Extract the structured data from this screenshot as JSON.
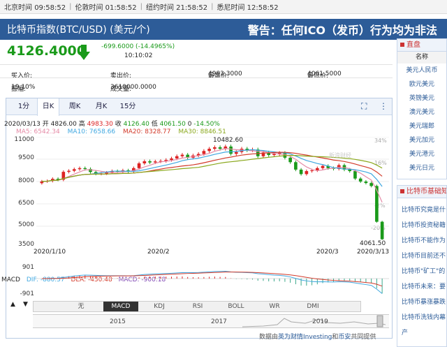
{
  "timebar": {
    "clocks": [
      {
        "city": "北京时间",
        "time": "09:58:52"
      },
      {
        "city": "伦敦时间",
        "time": "01:58:52"
      },
      {
        "city": "纽约时间",
        "time": "21:58:52"
      },
      {
        "city": "悉尼时间",
        "time": "12:58:52"
      }
    ]
  },
  "header": {
    "title": "比特币指数(BTC/USD) (美元/个)",
    "warning": "警告：任何ICO（发币）行为均为非法"
  },
  "quote": {
    "price": "4126.4000",
    "change": "-699.6000 (-14.4965%)",
    "time": "10:10:02",
    "bid_label": "买入价:",
    "bid_value": "--",
    "ask_label": "卖出价:",
    "ask_value": "--",
    "high_label": "最高价:",
    "high_value": "4983.3000",
    "low_label": "最低价:",
    "low_value": "4061.5000",
    "amplitude_label": "振幅:",
    "amplitude_value": "19.10%",
    "volume_label": "成交量:",
    "volume_value": "3610000.0000",
    "down_color": "#1a9a1a"
  },
  "chart_tabs": [
    "1分",
    "日K",
    "周K",
    "月K",
    "15分"
  ],
  "chart_tools": [
    "fullscreen-icon",
    "more-icon"
  ],
  "ohlc": {
    "date": "2020/03/13",
    "open_label": "开",
    "open": "4826.00",
    "high_label": "高",
    "high": "4983.30",
    "close_label": "收",
    "close": "4126.40",
    "low_label": "低",
    "low": "4061.50",
    "volume": "0",
    "pct": "-14.50%"
  },
  "ma": [
    {
      "label": "MA5: 6542.34",
      "color": "#e58aa6"
    },
    {
      "label": "MA10: 7658.66",
      "color": "#3fa7e0"
    },
    {
      "label": "MA20: 8328.77",
      "color": "#d23a2a"
    },
    {
      "label": "MA30: 8846.51",
      "color": "#8aa81c"
    }
  ],
  "watermark": "新浪财经",
  "chart_data": {
    "type": "candlestick",
    "y_ticks": [
      "11000",
      "9500",
      "8000",
      "6500",
      "5000",
      "3500"
    ],
    "ylim": [
      3500,
      11000
    ],
    "pct_ticks": [
      "34%",
      "16%",
      "-2%",
      "-20%"
    ],
    "x_labels": [
      "2020/1/10",
      "2020/2",
      "2020/3",
      "2020/3/13"
    ],
    "annotations": [
      "10482.60",
      "4061.50"
    ],
    "closes": [
      8010,
      8040,
      8180,
      8120,
      8650,
      8720,
      8830,
      8900,
      8840,
      8640,
      8520,
      8540,
      8600,
      8700,
      8680,
      8750,
      8670,
      8900,
      9220,
      9360,
      9280,
      9350,
      9380,
      9450,
      9550,
      9700,
      9800,
      9600,
      9750,
      9850,
      10050,
      10200,
      10300,
      10200,
      10350,
      9860,
      9980,
      10200,
      10100,
      10150,
      9700,
      9950,
      9780,
      9850,
      9920,
      9600,
      9300,
      8800,
      8500,
      8700,
      8750,
      8900,
      9050,
      8900,
      8850,
      9100,
      8800,
      8700,
      8200,
      8000,
      7900,
      7700,
      5300,
      4126
    ],
    "up_color": "#d22",
    "down_color": "#1a9a1a"
  },
  "macd": {
    "label": "MACD",
    "dif_label": "DIF: -880.57",
    "dea_label": "DEA: -430.48",
    "macd_label": "MACD: -900.18",
    "y_ticks": [
      "901",
      "-901"
    ]
  },
  "indicator_tabs": [
    "无",
    "MACD",
    "KDJ",
    "RSI",
    "BOLL",
    "WR",
    "DMI"
  ],
  "indicator_active": 1,
  "overview_years": [
    "2015",
    "2017",
    "2019"
  ],
  "source": {
    "prefix": "数据由",
    "link1": "英为财情Investing",
    "mid": "和",
    "link2": "币安",
    "suffix": "共同提供"
  },
  "sidebar": {
    "direct_title": "直盘",
    "direct_col": "名称",
    "direct_items": [
      "美元人民币",
      "欧元美元",
      "英镑美元",
      "澳元美元",
      "美元瑞郎",
      "美元加元",
      "美元港元",
      "美元日元"
    ],
    "basics_title": "比特币基础知识",
    "basics_items": [
      "比特币究竟是什么",
      "比特币投资秘籍",
      "比特币不能作为",
      "比特币目前还不",
      "比特币\"矿工\"的",
      "比特币未来：要",
      "比特币暴涨暴跌",
      "比特币洗钱内幕",
      "产"
    ]
  }
}
